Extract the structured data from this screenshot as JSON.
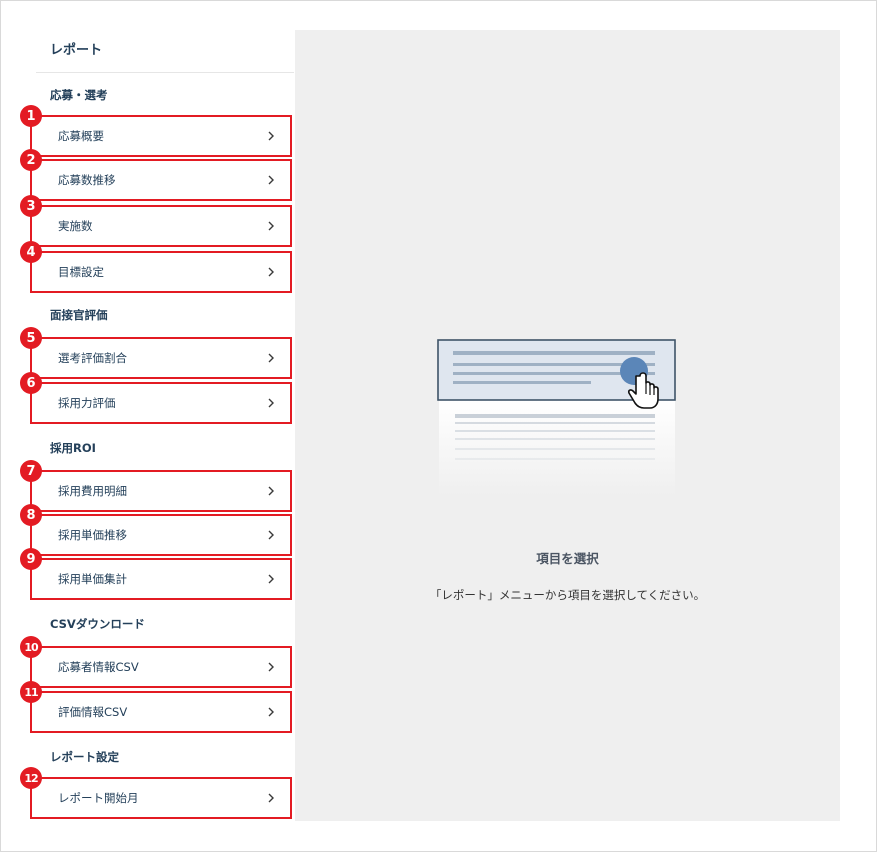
{
  "sidebar": {
    "title": "レポート",
    "sections": [
      {
        "header": "応募・選考",
        "items": [
          {
            "badge": "1",
            "label": "応募概要"
          },
          {
            "badge": "2",
            "label": "応募数推移"
          },
          {
            "badge": "3",
            "label": "実施数"
          },
          {
            "badge": "4",
            "label": "目標設定"
          }
        ]
      },
      {
        "header": "面接官評価",
        "items": [
          {
            "badge": "5",
            "label": "選考評価割合"
          },
          {
            "badge": "6",
            "label": "採用力評価"
          }
        ]
      },
      {
        "header": "採用ROI",
        "items": [
          {
            "badge": "7",
            "label": "採用費用明細"
          },
          {
            "badge": "8",
            "label": "採用単価推移"
          },
          {
            "badge": "9",
            "label": "採用単価集計"
          }
        ]
      },
      {
        "header": "CSVダウンロード",
        "items": [
          {
            "badge": "10",
            "label": "応募者情報CSV"
          },
          {
            "badge": "11",
            "label": "評価情報CSV"
          }
        ]
      },
      {
        "header": "レポート設定",
        "items": [
          {
            "badge": "12",
            "label": "レポート開始月"
          }
        ]
      }
    ]
  },
  "main": {
    "empty_title": "項目を選択",
    "empty_description": "「レポート」メニューから項目を選択してください。",
    "illustration_icon": "pointer-hand-icon"
  },
  "colors": {
    "badge_red": "#e31b23",
    "panel_gray": "#efefef",
    "text_navy": "#24405a",
    "accent_blue": "#5b86b8"
  }
}
